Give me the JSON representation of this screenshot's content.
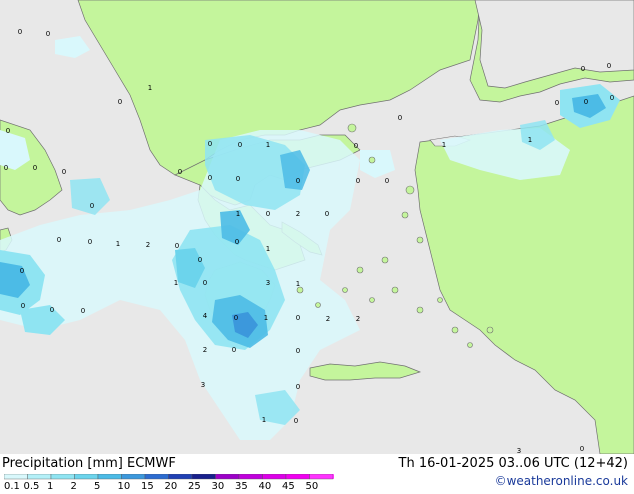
{
  "footer": {
    "title": "Precipitation [mm]  ECMWF",
    "validity": "Th 16-01-2025 03..06 UTC (12+42)",
    "credit": "©weatheronline.co.uk"
  },
  "legend": {
    "ticks": [
      "0.1",
      "0.5",
      "1",
      "2",
      "5",
      "10",
      "15",
      "20",
      "25",
      "30",
      "35",
      "40",
      "45",
      "50"
    ],
    "colors": [
      "#d9f8fc",
      "#b4f0f8",
      "#8fe4f2",
      "#6cd4ec",
      "#4cbbe6",
      "#3c98dc",
      "#2c6cd0",
      "#2040b4",
      "#18208c",
      "#9c00c8",
      "#c000dc",
      "#dc00e8",
      "#f000f0",
      "#ff33ff"
    ]
  },
  "colors": {
    "sea": "#e8e8e8",
    "land": "#c4f59c",
    "border": "#707070",
    "precip_light": "#d9f8fc",
    "precip_mid": "#8fe4f2",
    "precip_heavy": "#4cbbe6",
    "precip_max": "#3c98dc"
  },
  "map_labels": [
    "0",
    "0",
    "0",
    "0",
    "0",
    "0",
    "0",
    "1",
    "0",
    "0",
    "0",
    "0",
    "0",
    "0",
    "0",
    "1",
    "0",
    "2",
    "0",
    "0",
    "0",
    "1",
    "2",
    "0",
    "1",
    "0",
    "0",
    "0",
    "0",
    "1",
    "0",
    "3",
    "1",
    "4",
    "0",
    "1",
    "0",
    "2",
    "2",
    "2",
    "0",
    "0",
    "3",
    "0",
    "1",
    "0",
    "0",
    "1",
    "0",
    "0",
    "0",
    "0",
    "0",
    "1",
    "3",
    "0",
    "0",
    "0",
    "0",
    "1",
    "0",
    "0"
  ]
}
